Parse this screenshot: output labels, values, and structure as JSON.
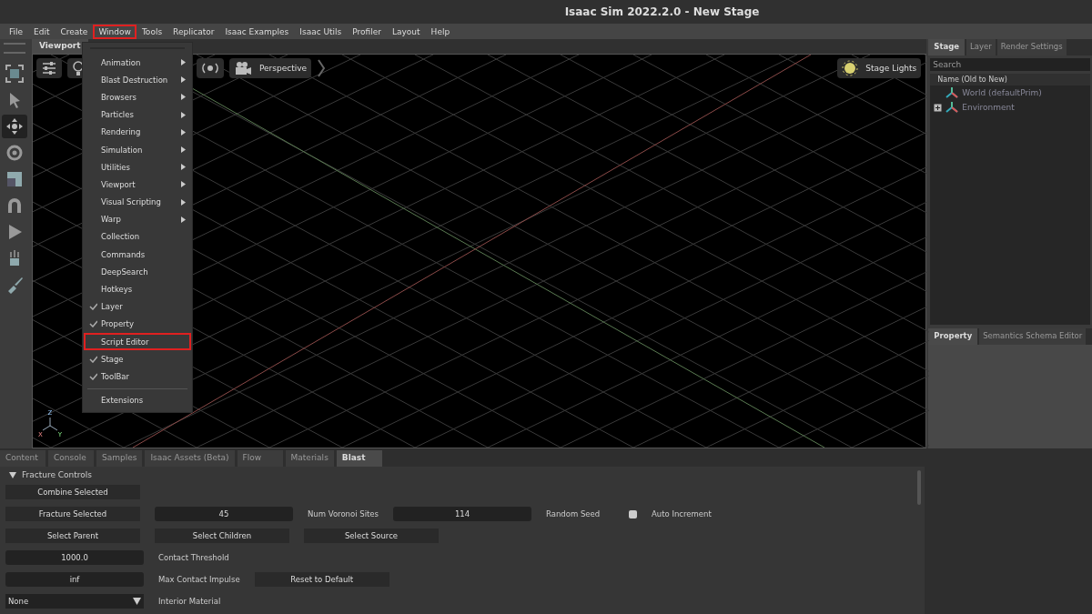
{
  "window": {
    "title": "Isaac Sim 2022.2.0 - New Stage"
  },
  "menu_bar": [
    {
      "label": "File",
      "highlighted": false
    },
    {
      "label": "Edit",
      "highlighted": false
    },
    {
      "label": "Create",
      "highlighted": false
    },
    {
      "label": "Window",
      "highlighted": true
    },
    {
      "label": "Tools",
      "highlighted": false
    },
    {
      "label": "Replicator",
      "highlighted": false
    },
    {
      "label": "Isaac Examples",
      "highlighted": false
    },
    {
      "label": "Isaac Utils",
      "highlighted": false
    },
    {
      "label": "Profiler",
      "highlighted": false
    },
    {
      "label": "Layout",
      "highlighted": false
    },
    {
      "label": "Help",
      "highlighted": false
    }
  ],
  "window_menu": [
    {
      "label": "Animation",
      "submenu": true,
      "checked": false,
      "highlighted": false
    },
    {
      "label": "Blast Destruction",
      "submenu": true,
      "checked": false,
      "highlighted": false
    },
    {
      "label": "Browsers",
      "submenu": true,
      "checked": false,
      "highlighted": false
    },
    {
      "label": "Particles",
      "submenu": true,
      "checked": false,
      "highlighted": false
    },
    {
      "label": "Rendering",
      "submenu": true,
      "checked": false,
      "highlighted": false
    },
    {
      "label": "Simulation",
      "submenu": true,
      "checked": false,
      "highlighted": false
    },
    {
      "label": "Utilities",
      "submenu": true,
      "checked": false,
      "highlighted": false
    },
    {
      "label": "Viewport",
      "submenu": true,
      "checked": false,
      "highlighted": false
    },
    {
      "label": "Visual Scripting",
      "submenu": true,
      "checked": false,
      "highlighted": false
    },
    {
      "label": "Warp",
      "submenu": true,
      "checked": false,
      "highlighted": false
    },
    {
      "label": "Collection",
      "submenu": false,
      "checked": false,
      "highlighted": false
    },
    {
      "label": "Commands",
      "submenu": false,
      "checked": false,
      "highlighted": false
    },
    {
      "label": "DeepSearch",
      "submenu": false,
      "checked": false,
      "highlighted": false
    },
    {
      "label": "Hotkeys",
      "submenu": false,
      "checked": false,
      "highlighted": false
    },
    {
      "label": "Layer",
      "submenu": false,
      "checked": true,
      "highlighted": false
    },
    {
      "label": "Property",
      "submenu": false,
      "checked": true,
      "highlighted": false
    },
    {
      "label": "Script Editor",
      "submenu": false,
      "checked": false,
      "highlighted": true
    },
    {
      "label": "Stage",
      "submenu": false,
      "checked": true,
      "highlighted": false
    },
    {
      "label": "ToolBar",
      "submenu": false,
      "checked": true,
      "highlighted": false
    },
    {
      "label": "Extensions",
      "submenu": false,
      "checked": false,
      "highlighted": false,
      "separator_before": true
    }
  ],
  "toolbar": [
    {
      "kind": "frame",
      "selected": false
    },
    {
      "kind": "select",
      "selected": false
    },
    {
      "kind": "move",
      "selected": true
    },
    {
      "kind": "rotate",
      "selected": false
    },
    {
      "kind": "scale",
      "selected": false
    },
    {
      "kind": "snap",
      "selected": false
    },
    {
      "kind": "play",
      "selected": false
    },
    {
      "kind": "physics",
      "selected": false
    },
    {
      "kind": "paint",
      "selected": false
    }
  ],
  "viewport": {
    "tab": "Viewport",
    "camera": "Perspective",
    "lights": "Stage Lights",
    "axes": [
      "Z",
      "X",
      "Y"
    ]
  },
  "stage_panel": {
    "tabs": [
      {
        "label": "Stage",
        "selected": true
      },
      {
        "label": "Layer",
        "selected": false
      },
      {
        "label": "Render Settings",
        "selected": false
      }
    ],
    "search": {
      "placeholder": "Search"
    },
    "column": "Name (Old to New)",
    "tree": [
      {
        "label": "World (defaultPrim)",
        "expandable": false
      },
      {
        "label": "Environment",
        "expandable": true
      }
    ]
  },
  "property_panel": {
    "tabs": [
      {
        "label": "Property",
        "selected": true
      },
      {
        "label": "Semantics Schema Editor",
        "selected": false
      }
    ]
  },
  "bottom_tabs": [
    {
      "label": "Content",
      "selected": false
    },
    {
      "label": "Console",
      "selected": false
    },
    {
      "label": "Samples",
      "selected": false
    },
    {
      "label": "Isaac Assets (Beta)",
      "selected": false
    },
    {
      "label": "Flow",
      "selected": false
    },
    {
      "label": "Materials",
      "selected": false
    },
    {
      "label": "Blast",
      "selected": true
    }
  ],
  "fracture_controls": {
    "title": "Fracture Controls",
    "expanded": true,
    "rows": [
      [
        {
          "kind": "button",
          "text": "Combine Selected"
        }
      ],
      [
        {
          "kind": "button",
          "text": "Fracture Selected"
        },
        {
          "kind": "field",
          "text": "45"
        },
        {
          "kind": "label",
          "text": "Num Voronoi Sites"
        },
        {
          "kind": "field",
          "text": "114"
        },
        {
          "kind": "label",
          "text": "Random Seed"
        },
        {
          "kind": "checkbox",
          "checked": false
        },
        {
          "kind": "label",
          "text": "Auto Increment"
        }
      ],
      [
        {
          "kind": "button",
          "text": "Select Parent"
        },
        {
          "kind": "button",
          "text": "Select Children"
        },
        {
          "kind": "button",
          "text": "Select Source"
        }
      ],
      [
        {
          "kind": "field",
          "text": "1000.0"
        },
        {
          "kind": "label",
          "text": "Contact Threshold"
        }
      ],
      [
        {
          "kind": "field",
          "text": "inf"
        },
        {
          "kind": "label",
          "text": "Max Contact Impulse"
        },
        {
          "kind": "button",
          "text": "Reset to Default"
        }
      ],
      [
        {
          "kind": "dropdown",
          "text": "None"
        },
        {
          "kind": "label",
          "text": "Interior Material"
        }
      ]
    ]
  }
}
